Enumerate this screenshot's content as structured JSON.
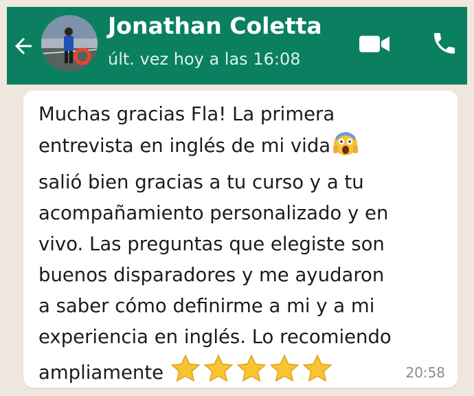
{
  "header": {
    "contact_name": "Jonathan Coletta",
    "last_seen": "últ. vez hoy a las 16:08",
    "background_color": "#0a8060",
    "icons": [
      "back-arrow-icon",
      "video-call-icon",
      "phone-icon"
    ]
  },
  "message": {
    "line1": "Muchas gracias Fla! La primera",
    "line2": "entrevista en inglés de mi vida",
    "emoji": "face-screaming-in-fear-emoji",
    "rest": "salió bien gracias a tu curso y a tu\nacompañamiento personalizado y en\nvivo. Las preguntas que elegiste son\nbuenos disparadores y me ayudaron\na saber cómo definirme a mi y a mi\nexperiencia en inglés. Lo recomiendo",
    "last_line": "ampliamente",
    "star_count": 5,
    "time": "20:58"
  }
}
